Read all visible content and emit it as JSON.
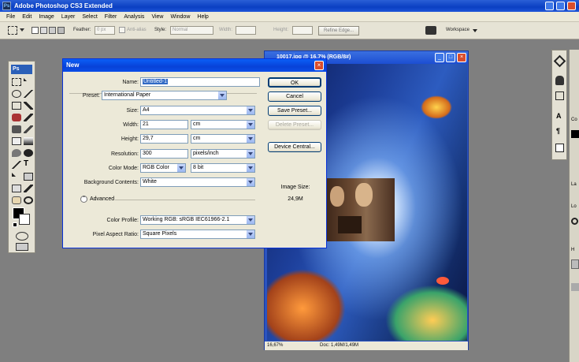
{
  "app": {
    "title": "Adobe Photoshop CS3 Extended",
    "logo": "Ps"
  },
  "menu": [
    "File",
    "Edit",
    "Image",
    "Layer",
    "Select",
    "Filter",
    "Analysis",
    "View",
    "Window",
    "Help"
  ],
  "options_bar": {
    "feather_label": "Feather:",
    "feather_value": "0 px",
    "antialias_label": "Anti-alias",
    "style_label": "Style:",
    "style_value": "Normal",
    "width_label": "Width:",
    "height_label": "Height:",
    "refine_edge": "Refine Edge...",
    "workspace": "Workspace"
  },
  "tools_panel": {
    "logo": "Ps"
  },
  "right_panel": {
    "labels": [
      "Co",
      "La",
      "Lo",
      "H"
    ]
  },
  "document": {
    "title": "10017.jpg @ 16,7% (RGB/8#)",
    "status_zoom": "16,67%",
    "status_doc": "Doc: 1,49M/1,49M"
  },
  "dialog": {
    "title": "New",
    "name_label": "Name:",
    "name_value": "Untitled-1",
    "preset_label": "Preset:",
    "preset_value": "International Paper",
    "size_label": "Size:",
    "size_value": "A4",
    "width_label": "Width:",
    "width_value": "21",
    "width_unit": "cm",
    "height_label": "Height:",
    "height_value": "29,7",
    "height_unit": "cm",
    "resolution_label": "Resolution:",
    "resolution_value": "300",
    "resolution_unit": "pixels/inch",
    "color_mode_label": "Color Mode:",
    "color_mode_value": "RGB Color",
    "bit_depth_value": "8 bit",
    "bg_label": "Background Contents:",
    "bg_value": "White",
    "advanced_label": "Advanced",
    "color_profile_label": "Color Profile:",
    "color_profile_value": "Working RGB:  sRGB IEC61966-2.1",
    "pixel_aspect_label": "Pixel Aspect Ratio:",
    "pixel_aspect_value": "Square Pixels",
    "buttons": {
      "ok": "OK",
      "cancel": "Cancel",
      "save_preset": "Save Preset...",
      "delete_preset": "Delete Preset...",
      "device_central": "Device Central..."
    },
    "image_size_label": "Image Size:",
    "image_size_value": "24,9M"
  },
  "colors": {
    "titlebar": "#0a3fc2",
    "dialog_border": "#0831d9",
    "chrome": "#ece9d8",
    "workspace": "#7f7f7f"
  }
}
